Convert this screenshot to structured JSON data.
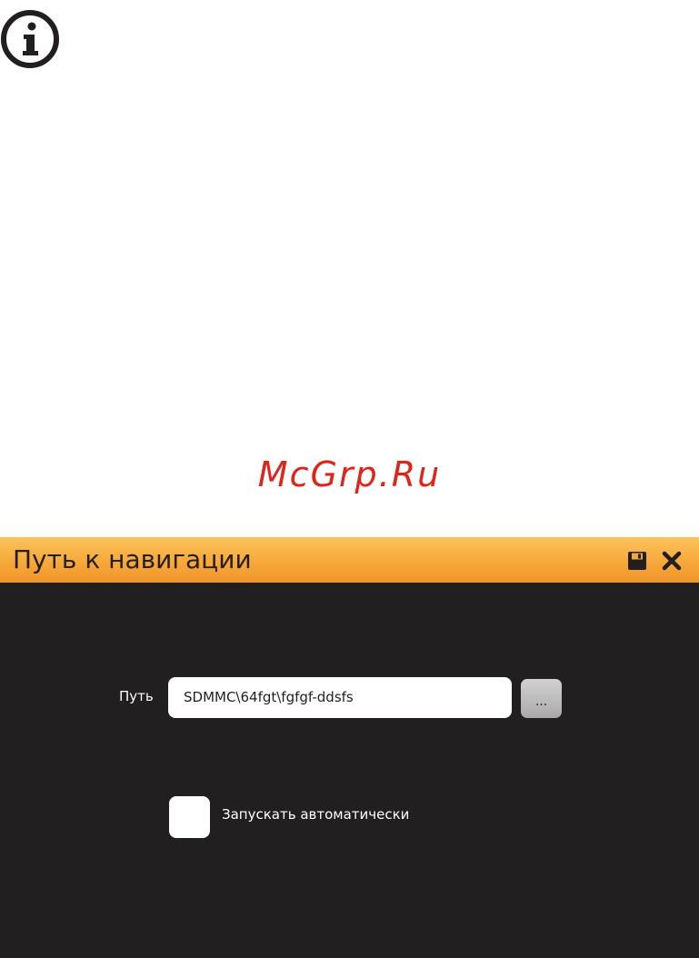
{
  "watermark": "McGrp.Ru",
  "info_icon": {
    "name": "info-icon",
    "glyph": "i"
  },
  "dialog": {
    "title": "Путь к навигации",
    "titlebar_colors": {
      "top": "#fbc45b",
      "bottom": "#f0952b"
    },
    "background": "#221f20",
    "save_icon": "save-icon",
    "close_icon": "close-icon",
    "path": {
      "label": "Путь",
      "value": "SDMMC\\64fgt\\fgfgf-ddsfs"
    },
    "browse_label": "...",
    "autostart": {
      "label": "Запускать автоматически",
      "checked": false
    }
  }
}
